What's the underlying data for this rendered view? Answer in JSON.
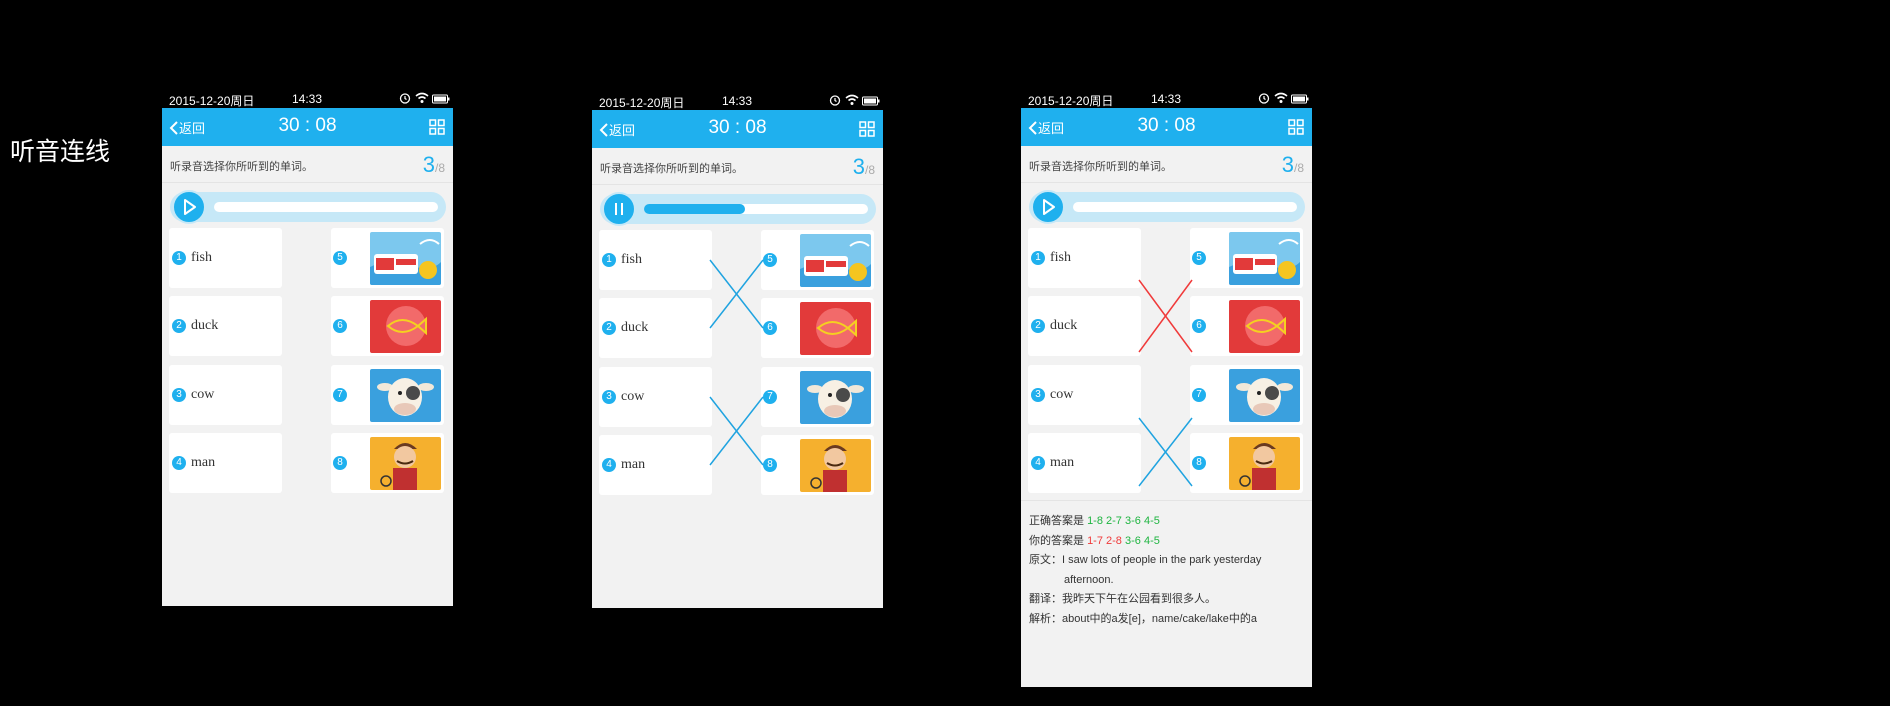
{
  "page_label": "听音连线",
  "status": {
    "date": "2015-12-20周日",
    "time": "14:33"
  },
  "nav": {
    "back_label": "返回",
    "timer": "30 : 08"
  },
  "instruction": "听录音选择你所听到的单词。",
  "progress": {
    "current": "3",
    "total": "/8"
  },
  "words": [
    {
      "num": "1",
      "word": "fish"
    },
    {
      "num": "2",
      "word": "duck"
    },
    {
      "num": "3",
      "word": "cow"
    },
    {
      "num": "4",
      "word": "man"
    }
  ],
  "images": [
    {
      "num": "5",
      "icon": "fish-snack-package-image"
    },
    {
      "num": "6",
      "icon": "fish-on-red-image"
    },
    {
      "num": "7",
      "icon": "cow-image"
    },
    {
      "num": "8",
      "icon": "man-image"
    }
  ],
  "screens": [
    {
      "state": "initial",
      "audio_playing": false,
      "audio_progress": 0,
      "connections": []
    },
    {
      "state": "connecting",
      "audio_playing": true,
      "audio_progress": 0.45,
      "connections": [
        [
          "1",
          "6"
        ],
        [
          "2",
          "5"
        ],
        [
          "3",
          "8"
        ],
        [
          "4",
          "7"
        ]
      ]
    },
    {
      "state": "result",
      "audio_playing": false,
      "audio_progress": 0,
      "connections": [
        [
          "1",
          "6",
          "wrong"
        ],
        [
          "2",
          "5",
          "wrong"
        ],
        [
          "3",
          "8",
          "correct"
        ],
        [
          "4",
          "7",
          "correct"
        ]
      ]
    }
  ],
  "result": {
    "correct_label": "正确答案是",
    "correct_pairs": [
      "1-8",
      "2-7",
      "3-6",
      "4-5"
    ],
    "yours_label": "你的答案是",
    "your_pairs": [
      {
        "text": "1-7",
        "status": "wrong"
      },
      {
        "text": "2-8",
        "status": "wrong"
      },
      {
        "text": "3-6",
        "status": "correct"
      },
      {
        "text": "4-5",
        "status": "correct"
      }
    ],
    "original_label": "原文：",
    "original_line1": "I saw lots of people in the park yesterday",
    "original_line2": "afternoon.",
    "translation_label": "翻译：",
    "translation": "我昨天下午在公园看到很多人。",
    "analysis_label": "解析：",
    "analysis": "about中的a发[e]，name/cake/lake中的a"
  },
  "colors": {
    "accent": "#1fb0ee",
    "correct": "#1fb541",
    "wrong": "#f03a3a",
    "line": "#1fa3e0"
  }
}
